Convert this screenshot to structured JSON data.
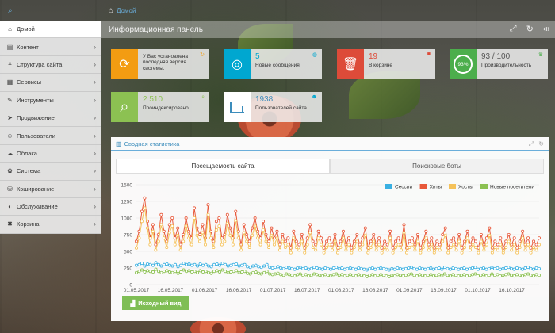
{
  "breadcrumb": {
    "home": "Домой"
  },
  "page": {
    "title": "Информационная панель"
  },
  "sidebar": {
    "items": [
      {
        "label": "Домой",
        "icon": "home-icon",
        "glyph": "⌂",
        "active": true
      },
      {
        "label": "Контент",
        "icon": "content-icon",
        "glyph": "▤"
      },
      {
        "label": "Структура сайта",
        "icon": "sitemap-icon",
        "glyph": "⌗"
      },
      {
        "label": "Сервисы",
        "icon": "services-icon",
        "glyph": "▦"
      },
      {
        "label": "Инструменты",
        "icon": "tools-icon",
        "glyph": "✎"
      },
      {
        "label": "Продвижение",
        "icon": "rocket-icon",
        "glyph": "➤"
      },
      {
        "label": "Пользователи",
        "icon": "users-icon",
        "glyph": "☺"
      },
      {
        "label": "Облака",
        "icon": "cloud-icon",
        "glyph": "☁"
      },
      {
        "label": "Система",
        "icon": "gear-icon",
        "glyph": "✿"
      },
      {
        "label": "Кэширование",
        "icon": "cache-icon",
        "glyph": "⛁"
      },
      {
        "label": "Обслуживание",
        "icon": "shield-icon",
        "glyph": "◐"
      },
      {
        "label": "Корзина",
        "icon": "trash-icon",
        "glyph": "✖"
      }
    ]
  },
  "widgets": {
    "update": {
      "label": "У Вас установлена последняя версия системы.",
      "color": "#f39c12"
    },
    "messages": {
      "value": "5",
      "label": "Новые сообщения",
      "color": "#00a7d0"
    },
    "trash": {
      "value": "19",
      "label": "В корзине",
      "color": "#dd4b39"
    },
    "performance": {
      "value": "93 / 100",
      "label": "Производительность",
      "badge": "93%",
      "color": "#4cae4c"
    },
    "indexed": {
      "value": "2 510",
      "label": "Проиндексировано",
      "color": "#8cc152"
    },
    "users": {
      "value": "1938",
      "label": "Пользователей сайта",
      "color": "#3c8dbc"
    }
  },
  "panel": {
    "title": "Сводная статистика",
    "tabs": [
      "Посещаемость сайта",
      "Поисковые боты"
    ],
    "reset_label": "Исходный вид"
  },
  "chart_data": {
    "type": "line",
    "ylim": [
      0,
      1500
    ],
    "yticks": [
      "0",
      "250",
      "500",
      "750",
      "1000",
      "1250",
      "1500"
    ],
    "xticks": [
      "01.05.2017",
      "16.05.2017",
      "01.06.2017",
      "16.06.2017",
      "01.07.2017",
      "16.07.2017",
      "01.08.2017",
      "16.08.2017",
      "01.09.2017",
      "16.09.2017",
      "01.10.2017",
      "16.10.2017"
    ],
    "legend_position": "top-right",
    "series": [
      {
        "name": "Сессии",
        "color": "#3ab0e2",
        "values": [
          290,
          300,
          320,
          280,
          310,
          300,
          290,
          330,
          300,
          280,
          300,
          310,
          290,
          280,
          300,
          270,
          290,
          320,
          300,
          310,
          290,
          300,
          280,
          310,
          290,
          300,
          280,
          270,
          300,
          310,
          290,
          320,
          300,
          280,
          290,
          300,
          310,
          280,
          290,
          300,
          270,
          260,
          280,
          290,
          270,
          260,
          280,
          300,
          260,
          250,
          260,
          270,
          250,
          240,
          260,
          250,
          240,
          230,
          250,
          260,
          240,
          250,
          230,
          240,
          260,
          250,
          240,
          230,
          250,
          240,
          230,
          250,
          260,
          240,
          250,
          230,
          240,
          250,
          240,
          230,
          250,
          240,
          230,
          220,
          240,
          250,
          230,
          240,
          250,
          240,
          230,
          220,
          240,
          230,
          250,
          240,
          230,
          240,
          250,
          260,
          240,
          230,
          250,
          240,
          230,
          240,
          250,
          230,
          240,
          250,
          230,
          260,
          240,
          230,
          250,
          240,
          230,
          240,
          250,
          230,
          240,
          250,
          260,
          230,
          240,
          250,
          230,
          240,
          260,
          240,
          250,
          230,
          240,
          250,
          260,
          240,
          230,
          250,
          240,
          230,
          250,
          260,
          240,
          230,
          250,
          240
        ]
      },
      {
        "name": "Хиты",
        "color": "#e8583a",
        "values": [
          650,
          800,
          1100,
          1300,
          950,
          700,
          900,
          600,
          750,
          1050,
          800,
          650,
          900,
          1000,
          700,
          850,
          600,
          750,
          1000,
          800,
          700,
          1150,
          850,
          750,
          900,
          700,
          1200,
          800,
          650,
          950,
          1000,
          700,
          750,
          1050,
          850,
          700,
          1100,
          800,
          600,
          900,
          750,
          650,
          850,
          1000,
          800,
          700,
          950,
          750,
          650,
          850,
          700,
          800,
          600,
          750,
          650,
          700,
          550,
          800,
          650,
          600,
          750,
          550,
          700,
          900,
          650,
          600,
          800,
          700,
          550,
          650,
          700,
          600,
          750,
          550,
          650,
          800,
          600,
          700,
          550,
          650,
          750,
          600,
          700,
          850,
          550,
          650,
          750,
          600,
          700,
          550,
          650,
          600,
          800,
          550,
          650,
          700,
          600,
          900,
          550,
          650,
          700,
          600,
          750,
          550,
          650,
          800,
          600,
          700,
          550,
          650,
          600,
          750,
          850,
          550,
          650,
          700,
          600,
          750,
          550,
          650,
          800,
          600,
          700,
          650,
          550,
          750,
          600,
          700,
          850,
          550,
          650,
          600,
          700,
          550,
          650,
          750,
          600,
          700,
          550,
          650,
          800,
          600,
          700,
          550,
          650,
          600,
          700
        ]
      },
      {
        "name": "Хосты",
        "color": "#f5c25a",
        "values": [
          550,
          700,
          950,
          1150,
          850,
          600,
          800,
          520,
          650,
          900,
          700,
          560,
          780,
          880,
          600,
          740,
          520,
          650,
          880,
          700,
          600,
          1000,
          740,
          650,
          780,
          600,
          1050,
          700,
          560,
          820,
          880,
          600,
          650,
          920,
          740,
          600,
          960,
          700,
          520,
          780,
          650,
          560,
          740,
          880,
          700,
          600,
          820,
          650,
          560,
          740,
          600,
          700,
          520,
          650,
          560,
          600,
          480,
          700,
          560,
          520,
          650,
          480,
          600,
          780,
          560,
          520,
          700,
          600,
          480,
          560,
          600,
          520,
          650,
          480,
          560,
          700,
          520,
          600,
          480,
          560,
          650,
          520,
          600,
          740,
          480,
          560,
          650,
          520,
          600,
          480,
          560,
          520,
          700,
          480,
          560,
          600,
          520,
          780,
          480,
          560,
          600,
          520,
          650,
          480,
          560,
          700,
          520,
          600,
          480,
          560,
          520,
          650,
          740,
          480,
          560,
          600,
          520,
          650,
          480,
          560,
          700,
          520,
          600,
          560,
          480,
          650,
          520,
          600,
          740,
          480,
          560,
          520,
          600,
          480,
          560,
          650,
          520,
          600,
          480,
          560,
          700,
          520,
          600,
          480,
          560,
          520,
          600
        ]
      },
      {
        "name": "Новые посетители",
        "color": "#8cc152",
        "values": [
          180,
          200,
          220,
          190,
          210,
          200,
          190,
          230,
          200,
          180,
          200,
          210,
          190,
          180,
          200,
          170,
          190,
          220,
          200,
          210,
          190,
          200,
          180,
          210,
          190,
          200,
          180,
          170,
          200,
          210,
          190,
          220,
          200,
          180,
          190,
          200,
          210,
          180,
          190,
          200,
          170,
          160,
          180,
          190,
          170,
          160,
          180,
          200,
          160,
          150,
          160,
          170,
          150,
          140,
          160,
          150,
          140,
          130,
          150,
          160,
          140,
          150,
          130,
          140,
          160,
          150,
          140,
          130,
          150,
          140,
          130,
          150,
          160,
          140,
          150,
          130,
          140,
          150,
          140,
          130,
          150,
          140,
          130,
          120,
          140,
          150,
          130,
          140,
          150,
          140,
          130,
          120,
          140,
          130,
          150,
          140,
          130,
          140,
          150,
          160,
          140,
          130,
          150,
          140,
          130,
          140,
          150,
          130,
          140,
          150,
          130,
          160,
          140,
          130,
          150,
          140,
          130,
          140,
          150,
          130,
          140,
          150,
          160,
          130,
          140,
          150,
          130,
          140,
          160,
          140,
          150,
          130,
          140,
          150,
          160,
          140,
          130,
          150,
          140,
          130,
          150,
          160,
          140,
          130,
          150,
          140
        ]
      }
    ]
  }
}
